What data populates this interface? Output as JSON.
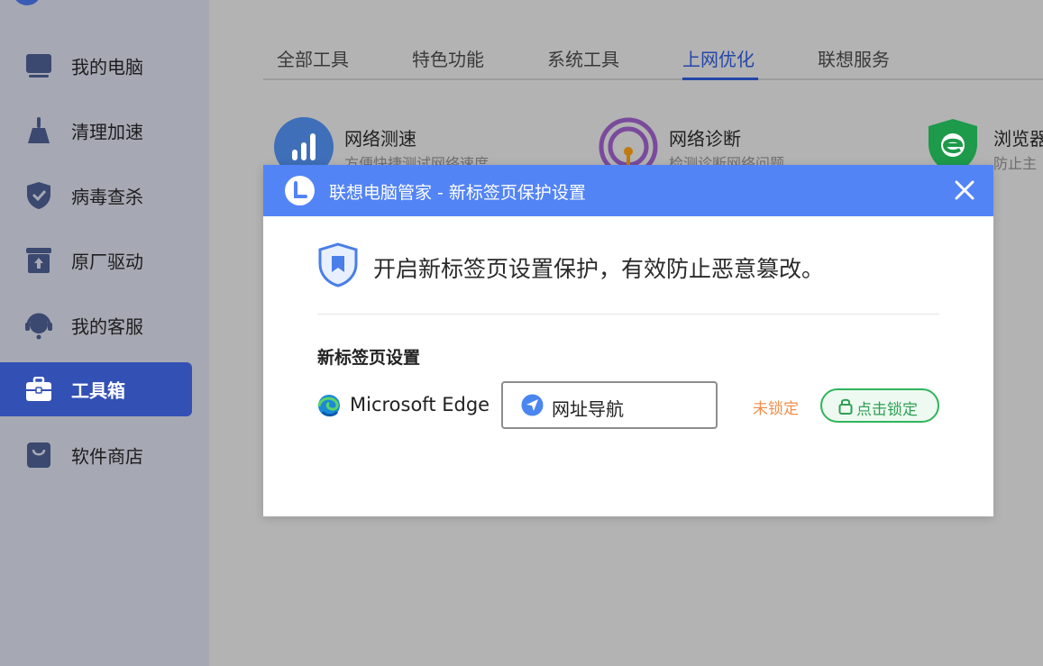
{
  "sidebar": {
    "items": [
      {
        "label": "我的电脑",
        "icon": "computer-icon"
      },
      {
        "label": "清理加速",
        "icon": "broom-icon"
      },
      {
        "label": "病毒查杀",
        "icon": "shield-icon"
      },
      {
        "label": "原厂驱动",
        "icon": "driver-upload-icon"
      },
      {
        "label": "我的客服",
        "icon": "headset-icon"
      },
      {
        "label": "工具箱",
        "icon": "toolbox-icon",
        "active": true
      },
      {
        "label": "软件商店",
        "icon": "shopping-bag-icon"
      }
    ]
  },
  "tabs": [
    {
      "label": "全部工具"
    },
    {
      "label": "特色功能"
    },
    {
      "label": "系统工具"
    },
    {
      "label": "上网优化",
      "active": true
    },
    {
      "label": "联想服务"
    }
  ],
  "tools": [
    {
      "name": "网络测速",
      "desc": "方便快捷测试网络速度",
      "icon": "speed-test-icon"
    },
    {
      "name": "网络诊断",
      "desc": "检测诊断网络问题",
      "icon": "network-diagnose-icon"
    },
    {
      "name": "浏览器",
      "desc": "防止主",
      "icon": "browser-shield-icon"
    }
  ],
  "dialog": {
    "title": "联想电脑管家 - 新标签页保护设置",
    "hero_text": "开启新标签页设置保护，有效防止恶意篡改。",
    "section_title": "新标签页设置",
    "browser_name": "Microsoft Edge",
    "selected_page": "网址导航",
    "lock_status": "未锁定",
    "lock_button": "点击锁定"
  },
  "colors": {
    "accent": "#3350b4",
    "dialog_header": "#5384f6",
    "status_orange": "#ef8f4d",
    "lock_green": "#2fb45b"
  }
}
